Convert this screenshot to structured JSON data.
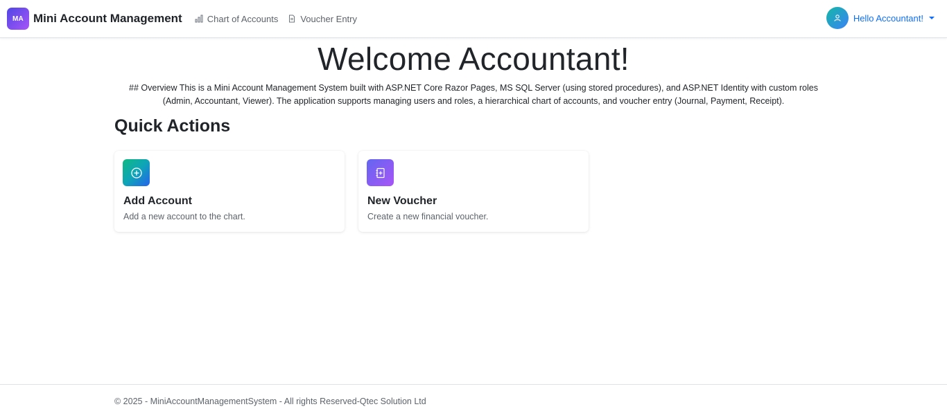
{
  "navbar": {
    "logo_text": "MA",
    "brand": "Mini Account Management",
    "links": [
      {
        "label": "Chart of Accounts",
        "icon": "bar-chart-icon"
      },
      {
        "label": "Voucher Entry",
        "icon": "document-icon"
      }
    ],
    "user": {
      "label": "Hello Accountant!",
      "icon": "user-icon"
    }
  },
  "main": {
    "welcome": "Welcome Accountant!",
    "overview": "## Overview This is a Mini Account Management System built with ASP.NET Core Razor Pages, MS SQL Server (using stored procedures), and ASP.NET Identity with custom roles (Admin, Accountant, Viewer). The application supports managing users and roles, a hierarchical chart of accounts, and voucher entry (Journal, Payment, Receipt).",
    "quick_actions_title": "Quick Actions",
    "cards": [
      {
        "title": "Add Account",
        "description": "Add a new account to the chart.",
        "icon": "plus-circle-icon"
      },
      {
        "title": "New Voucher",
        "description": "Create a new financial voucher.",
        "icon": "journal-plus-icon"
      }
    ]
  },
  "footer": {
    "text": "© 2025 - MiniAccountManagementSystem - All rights Reserved-Qtec Solution Ltd"
  },
  "colors": {
    "link": "#0d6efd",
    "brand_gradient": [
      "#4f46e5",
      "#a855f7"
    ],
    "teal_gradient": [
      "#10b981",
      "#2563eb"
    ]
  }
}
